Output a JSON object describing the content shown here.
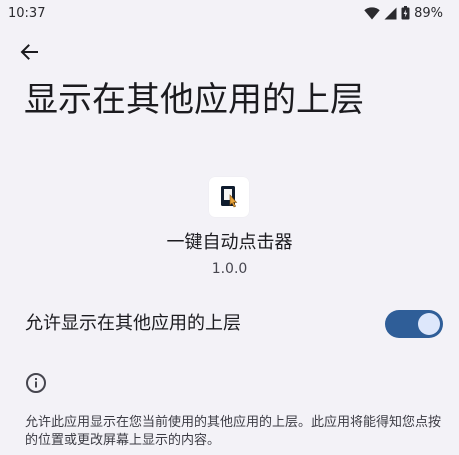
{
  "status_bar": {
    "time": "10:37",
    "battery": "89%"
  },
  "header": {
    "title": "显示在其他应用的上层"
  },
  "app": {
    "icon": "auto-clicker-app-icon",
    "name": "一键自动点击器",
    "version": "1.0.0"
  },
  "permission": {
    "label": "允许显示在其他应用的上层",
    "enabled": true
  },
  "info": {
    "icon": "info-icon",
    "description": "允许此应用显示在您当前使用的其他应用的上层。此应用将能得知您点按的位置或更改屏幕上显示的内容。"
  },
  "colors": {
    "background": "#f3f2f7",
    "toggle_track": "#2f5e98",
    "toggle_thumb": "#dde7fb"
  }
}
